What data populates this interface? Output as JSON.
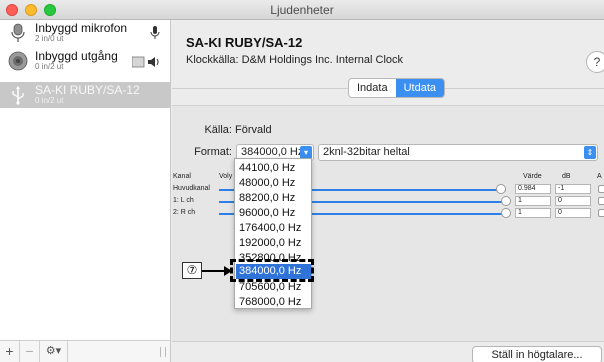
{
  "window": {
    "title": "Ljudenheter"
  },
  "sidebar": {
    "devices": [
      {
        "name": "Inbyggd mikrofon",
        "sub": "2 in/0 ut",
        "icon": "microphone-icon",
        "badge": "microphone-icon"
      },
      {
        "name": "Inbyggd utgång",
        "sub": "0 in/2 ut",
        "icon": "speaker-icon",
        "badge": "volume-icon"
      },
      {
        "name": "SA-KI RUBY/SA-12",
        "sub": "0 in/2 ut",
        "icon": "usb-icon"
      }
    ],
    "bottom": {
      "add": "+",
      "remove": "−",
      "gear": "⚙▾"
    }
  },
  "main": {
    "device_title": "SA-KI RUBY/SA-12",
    "clock_label": "Klockkälla:",
    "clock_value": "D&M Holdings Inc. Internal Clock",
    "help": "?",
    "tabs": [
      {
        "label": "Indata",
        "active": false
      },
      {
        "label": "Utdata",
        "active": true
      }
    ],
    "source_label": "Källa:",
    "source_value": "Förvald",
    "format_label": "Format:",
    "format_rate": "384000,0 Hz",
    "format_bits": "2knl-32bitar heltal",
    "table": {
      "headers": {
        "channel": "Kanal",
        "volume": "Voly",
        "value": "Värde",
        "db": "dB",
        "mute": "A"
      },
      "rows": [
        {
          "name": "Huvudkanal",
          "value": "0.984",
          "db": "-1",
          "level": 0.984
        },
        {
          "name": "1: L ch",
          "value": "1",
          "db": "0",
          "level": 1
        },
        {
          "name": "2: R ch",
          "value": "1",
          "db": "0",
          "level": 1
        }
      ]
    },
    "speaker_button": "Ställ in högtalare..."
  },
  "dropdown": {
    "items": [
      "44100,0 Hz",
      "48000,0 Hz",
      "88200,0 Hz",
      "96000,0 Hz",
      "176400,0 Hz",
      "192000,0 Hz",
      "352800,0 Hz",
      "384000,0 Hz",
      "705600,0 Hz",
      "768000,0 Hz"
    ],
    "highlighted_index": 7
  },
  "annotation": {
    "callout": "⑦"
  },
  "colors": {
    "accent": "#3b8ff0",
    "highlight": "#2f72d8",
    "selected_row": "#c8c8c8"
  }
}
